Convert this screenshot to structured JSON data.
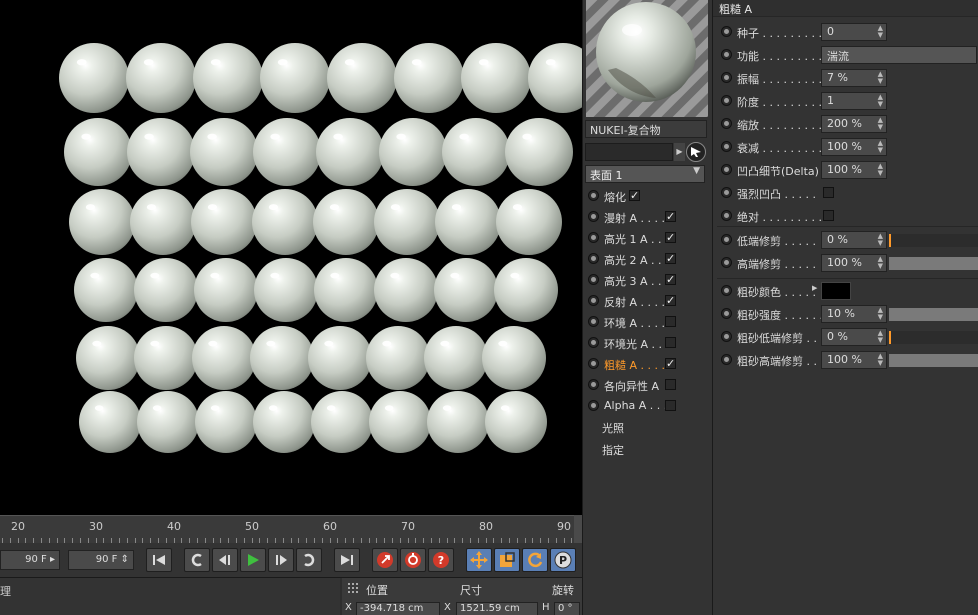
{
  "timeline": {
    "ticks": [
      {
        "label": "20",
        "pos": 0
      },
      {
        "label": "30",
        "pos": 1
      },
      {
        "label": "40",
        "pos": 2
      },
      {
        "label": "50",
        "pos": 3
      },
      {
        "label": "60",
        "pos": 4
      },
      {
        "label": "70",
        "pos": 5
      },
      {
        "label": "80",
        "pos": 6
      },
      {
        "label": "90",
        "pos": 7
      }
    ]
  },
  "transport": {
    "end_frame_left": "90 F",
    "end_frame_right": "90 F"
  },
  "coords": {
    "left_label": "理",
    "position_header": "位置",
    "size_header": "尺寸",
    "rotation_header": "旋转",
    "x_label": "X",
    "x_value": "-394.718 cm",
    "sx_label": "X",
    "sx_value": "1521.59 cm",
    "h_label": "H",
    "h_value": "0 °"
  },
  "material": {
    "name": "NUKEI-复合物",
    "surface_select": "表面 1",
    "channels": [
      {
        "label": "熔化",
        "checked": true,
        "active": false
      },
      {
        "label": "漫射 A . . . .",
        "checked": true,
        "active": false
      },
      {
        "label": "高光 1 A . .",
        "checked": true,
        "active": false
      },
      {
        "label": "高光 2 A . .",
        "checked": true,
        "active": false
      },
      {
        "label": "高光 3 A . .",
        "checked": true,
        "active": false
      },
      {
        "label": "反射 A . . . .",
        "checked": true,
        "active": false
      },
      {
        "label": "环境 A . . . .",
        "checked": false,
        "active": false
      },
      {
        "label": "环境光 A . . .",
        "checked": false,
        "active": false
      },
      {
        "label": "粗糙 A . . . .",
        "checked": true,
        "active": true
      },
      {
        "label": "各向异性 A",
        "checked": false,
        "active": false
      },
      {
        "label": "Alpha A . . .",
        "checked": false,
        "active": false
      }
    ],
    "extra_items": [
      "光照",
      "指定"
    ]
  },
  "attributes": {
    "title": "粗糙 A",
    "params": [
      {
        "label": "种子 . . . . . . . . .",
        "value": "0",
        "kind": "spin"
      },
      {
        "label": "功能 . . . . . . . . .",
        "value": "湍流",
        "kind": "select"
      },
      {
        "label": "振幅 . . . . . . . . .",
        "value": "7 %",
        "kind": "spin"
      },
      {
        "label": "阶度 . . . . . . . . .",
        "value": "1",
        "kind": "spin"
      },
      {
        "label": "缩放 . . . . . . . . .",
        "value": "200 %",
        "kind": "spin"
      },
      {
        "label": "衰减 . . . . . . . . .",
        "value": "100 %",
        "kind": "spin"
      },
      {
        "label": "凹凸细节(Delta)",
        "value": "100 %",
        "kind": "spin"
      },
      {
        "label": "强烈凹凸 . . . . .",
        "value": "",
        "kind": "check"
      },
      {
        "label": "绝对 . . . . . . . . .",
        "value": "",
        "kind": "check"
      }
    ],
    "params2": [
      {
        "label": "低端修剪 . . . . .",
        "value": "0 %",
        "kind": "slider",
        "fill": 0
      },
      {
        "label": "高端修剪 . . . . .",
        "value": "100 %",
        "kind": "slider",
        "fill": 1
      }
    ],
    "params3": [
      {
        "label": "粗砂颜色 . . . . .",
        "value": "",
        "kind": "color",
        "color": "#000000"
      },
      {
        "label": "粗砂强度 . . . . . .",
        "value": "10 %",
        "kind": "slider",
        "fill": 1
      },
      {
        "label": "粗砂低端修剪 . .",
        "value": "0 %",
        "kind": "slider",
        "fill": 0
      },
      {
        "label": "粗砂高端修剪 . .",
        "value": "100 %",
        "kind": "slider",
        "fill": 1
      }
    ]
  },
  "colors": {
    "accent": "#ff9a2a",
    "sphere": "#c9cfc6",
    "play_green": "#3fbf3f",
    "record_red": "#d23a2a"
  }
}
